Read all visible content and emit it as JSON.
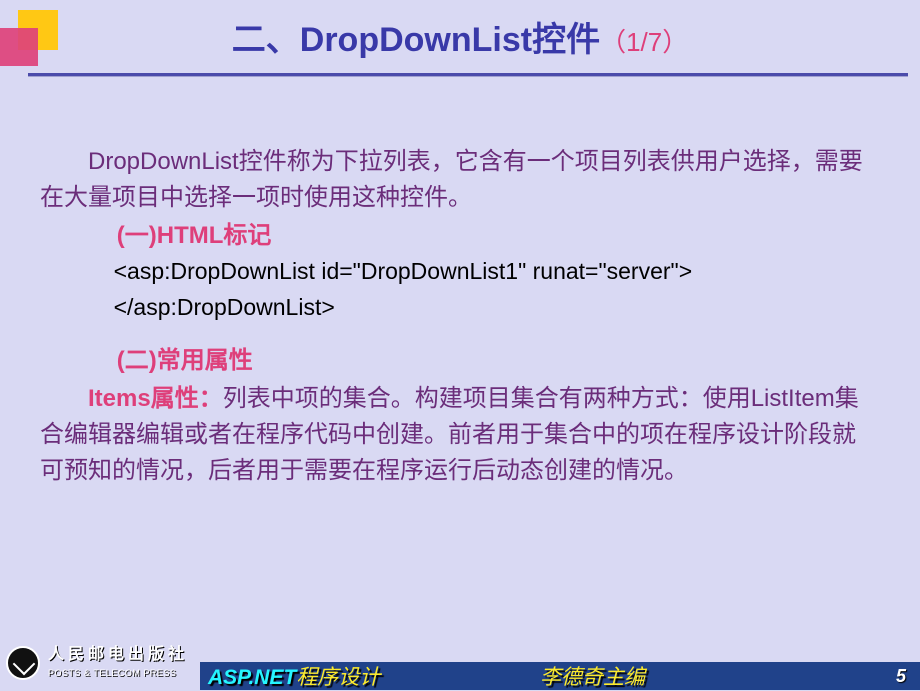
{
  "title": {
    "main": "二、DropDownList控件",
    "pager": "（1/7）"
  },
  "para1": "DropDownList控件称为下拉列表，它含有一个项目列表供用户选择，需要在大量项目中选择一项时使用这种控件。",
  "section1": {
    "heading": "(一)HTML标记",
    "code_line1": "<asp:DropDownList id=\"DropDownList1\" runat=\"server\">",
    "code_line2": "</asp:DropDownList>"
  },
  "section2": {
    "heading": "(二)常用属性",
    "lead": "Items属性：",
    "body": "列表中项的集合。构建项目集合有两种方式：使用ListItem集合编辑器编辑或者在程序代码中创建。前者用于集合中的项在程序设计阶段就可预知的情况，后者用于需要在程序运行后动态创建的情况。"
  },
  "footer": {
    "publisher_cn": "人民邮电出版社",
    "publisher_en": "POSTS & TELECOM PRESS",
    "book_asp": "ASP.NET",
    "book_rest": "程序设计",
    "author": "李德奇主编",
    "page": "5"
  }
}
